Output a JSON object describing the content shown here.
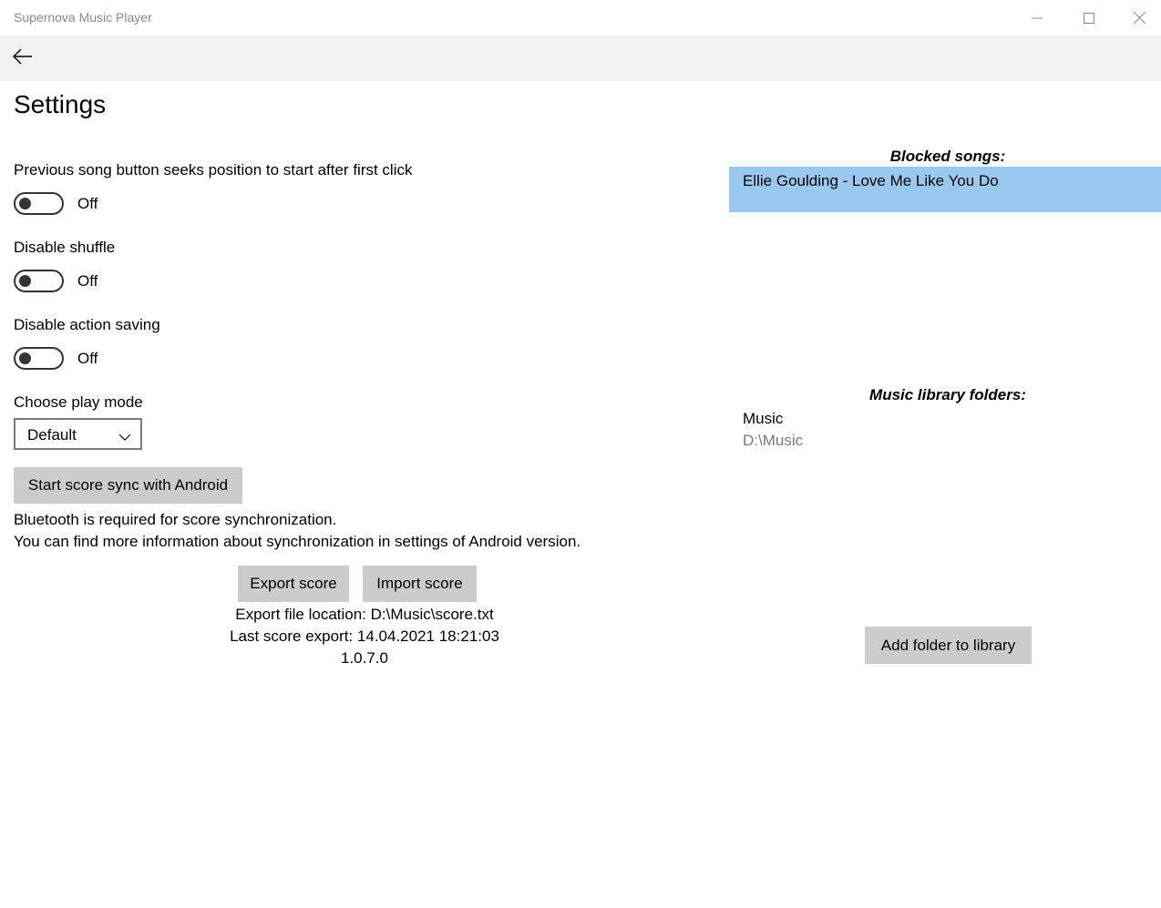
{
  "window": {
    "title": "Supernova Music Player",
    "minimize_icon": "minimize-icon",
    "maximize_icon": "maximize-icon",
    "close_icon": "close-icon"
  },
  "nav": {
    "back_icon": "back-arrow-icon"
  },
  "page": {
    "title": "Settings"
  },
  "settings": {
    "previous_seek": {
      "label": "Previous song button seeks position to start after first click",
      "state": "Off",
      "on": false
    },
    "disable_shuffle": {
      "label": "Disable shuffle",
      "state": "Off",
      "on": false
    },
    "disable_action_saving": {
      "label": "Disable action saving",
      "state": "Off",
      "on": false
    },
    "play_mode": {
      "label": "Choose play mode",
      "selected": "Default"
    }
  },
  "sync": {
    "button_label": "Start score sync with Android",
    "info_line1": "Bluetooth is required for score synchronization.",
    "info_line2": "You can find more information about synchronization in settings of Android version."
  },
  "score": {
    "export_label": "Export score",
    "import_label": "Import score",
    "export_location": "Export file location: D:\\Music\\score.txt",
    "last_export": "Last score export: 14.04.2021 18:21:03",
    "version": "1.0.7.0"
  },
  "blocked_songs": {
    "header": "Blocked songs:",
    "items": [
      "Ellie Goulding - Love Me Like You Do"
    ]
  },
  "library": {
    "header": "Music library folders:",
    "folders": [
      {
        "name": "Music",
        "path": "D:\\Music"
      }
    ],
    "add_button_label": "Add folder to library"
  },
  "colors": {
    "selection": "#99c9ef",
    "button": "#cccccc",
    "backbar": "#f2f2f2"
  }
}
